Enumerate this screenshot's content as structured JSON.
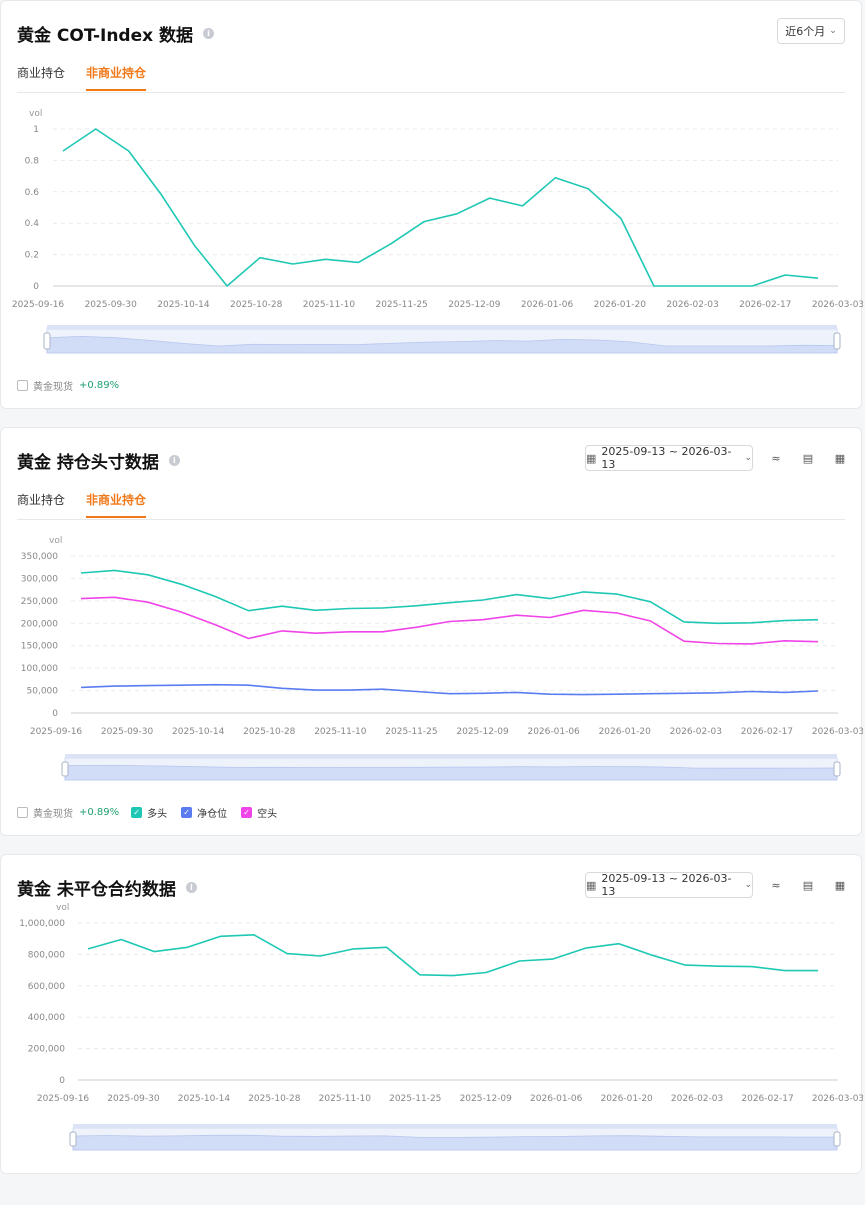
{
  "card1": {
    "title": "黄金 COT-Index 数据",
    "tabs": [
      "商业持仓",
      "非商业持仓"
    ],
    "active_tab": 1,
    "period_label": "近6个月",
    "legend": {
      "spot_label": "黄金现货",
      "spot_change": "+0.89%"
    }
  },
  "card2": {
    "title": "黄金 持仓头寸数据",
    "tabs": [
      "商业持仓",
      "非商业持仓"
    ],
    "active_tab": 1,
    "date_range": "2025-09-13 ~ 2026-03-13",
    "legend": {
      "spot_label": "黄金现货",
      "spot_change": "+0.89%",
      "items": [
        "多头",
        "净仓位",
        "空头"
      ]
    }
  },
  "card3": {
    "title": "黄金 未平仓合约数据",
    "date_range": "2025-09-13 ~ 2026-03-13"
  },
  "icons": {
    "info": "info-icon",
    "calendar": "calendar-icon",
    "chevron": "chevron-down-icon",
    "line_tool": "line-chart-icon",
    "bar_tool": "bar-chart-icon",
    "table_tool": "table-icon"
  },
  "colors": {
    "accent": "#f07a1a",
    "long": "#1ec8b4",
    "net": "#5b7cf0",
    "short": "#f044e8",
    "spot_change": "#20a070"
  },
  "chart_data": [
    {
      "type": "line",
      "ylabel": "vol",
      "ylim": [
        0,
        1
      ],
      "yticks": [
        0,
        0.2,
        0.4,
        0.6,
        0.8,
        1
      ],
      "ytick_labels": [
        "0",
        "0.2",
        "0.4",
        "0.6",
        "0.8",
        "1"
      ],
      "xtick_labels": [
        "2025-09-16",
        "2025-09-30",
        "2025-10-14",
        "2025-10-28",
        "2025-11-10",
        "2025-11-25",
        "2025-12-09",
        "2026-01-06",
        "2026-01-20",
        "2026-02-03",
        "2026-02-17",
        "2026-03-03"
      ],
      "x": [
        "2025-09-09",
        "2025-09-16",
        "2025-09-23",
        "2025-09-30",
        "2025-10-07",
        "2025-10-14",
        "2025-10-21",
        "2025-10-28",
        "2025-11-04",
        "2025-11-10",
        "2025-11-18",
        "2025-11-25",
        "2025-12-02",
        "2025-12-09",
        "2025-12-16",
        "2026-01-06",
        "2026-01-13",
        "2026-01-20",
        "2026-01-27",
        "2026-02-03",
        "2026-02-10",
        "2026-02-17",
        "2026-02-24",
        "2026-03-03"
      ],
      "series": [
        {
          "color": "#1ec8b4",
          "values": [
            0.86,
            1.0,
            0.86,
            0.58,
            0.26,
            0.0,
            0.18,
            0.14,
            0.17,
            0.15,
            0.27,
            0.41,
            0.46,
            0.56,
            0.51,
            0.69,
            0.62,
            0.43,
            0.0,
            0.0,
            0.0,
            0.0,
            0.07,
            0.05
          ]
        }
      ]
    },
    {
      "type": "line",
      "ylabel": "vol",
      "ylim": [
        0,
        350000
      ],
      "yticks": [
        0,
        50000,
        100000,
        150000,
        200000,
        250000,
        300000,
        350000
      ],
      "ytick_labels": [
        "0",
        "50,000",
        "100,000",
        "150,000",
        "200,000",
        "250,000",
        "300,000",
        "350,000"
      ],
      "xtick_labels": [
        "2025-09-16",
        "2025-09-30",
        "2025-10-14",
        "2025-10-28",
        "2025-11-10",
        "2025-11-25",
        "2025-12-09",
        "2026-01-06",
        "2026-01-20",
        "2026-02-03",
        "2026-02-17",
        "2026-03-03"
      ],
      "series": [
        {
          "name": "多头",
          "color": "#1ec8b4",
          "values": [
            312000,
            318000,
            308000,
            287000,
            260000,
            228000,
            238000,
            229000,
            233000,
            234000,
            239000,
            246000,
            252000,
            264000,
            255000,
            270000,
            265000,
            248000,
            203000,
            200000,
            201000,
            206000,
            208000
          ]
        },
        {
          "name": "净仓位",
          "color": "#5b7cf0",
          "values": [
            57000,
            60000,
            61000,
            62000,
            63000,
            62000,
            55000,
            51000,
            51000,
            53000,
            48000,
            43000,
            44000,
            46000,
            42000,
            41000,
            42000,
            43000,
            44000,
            45000,
            48000,
            46000,
            49000
          ]
        },
        {
          "name": "空头",
          "color": "#f044e8",
          "values": [
            255000,
            258000,
            247000,
            225000,
            197000,
            166000,
            183000,
            178000,
            181000,
            181000,
            191000,
            204000,
            208000,
            218000,
            213000,
            229000,
            223000,
            205000,
            160000,
            155000,
            154000,
            161000,
            159000
          ]
        }
      ]
    },
    {
      "type": "line",
      "ylabel": "vol",
      "ylim": [
        0,
        1000000
      ],
      "yticks": [
        0,
        200000,
        400000,
        600000,
        800000,
        1000000
      ],
      "ytick_labels": [
        "0",
        "200,000",
        "400,000",
        "600,000",
        "800,000",
        "1,000,000"
      ],
      "xtick_labels": [
        "2025-09-16",
        "2025-09-30",
        "2025-10-14",
        "2025-10-28",
        "2025-11-10",
        "2025-11-25",
        "2025-12-09",
        "2026-01-06",
        "2026-01-20",
        "2026-02-03",
        "2026-02-17",
        "2026-03-03"
      ],
      "series": [
        {
          "color": "#1ec8b4",
          "values": [
            835000,
            895000,
            818000,
            845000,
            915000,
            925000,
            805000,
            790000,
            835000,
            845000,
            670000,
            665000,
            685000,
            758000,
            770000,
            840000,
            868000,
            795000,
            732000,
            725000,
            722000,
            697000,
            697000
          ]
        }
      ]
    }
  ]
}
